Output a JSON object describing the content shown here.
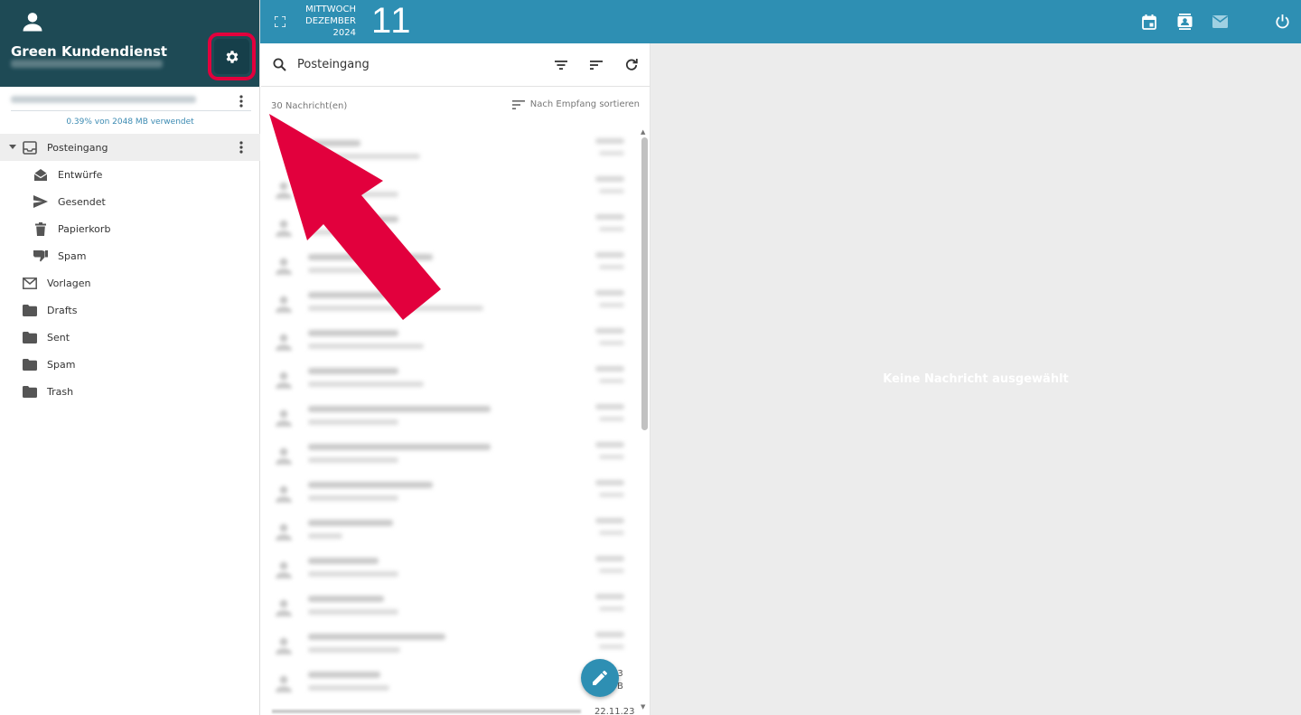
{
  "sidebar": {
    "user_name": "Green Kundendienst",
    "quota_text": "0.39% von 2048 MB verwendet",
    "folders": [
      {
        "label": "Posteingang",
        "icon": "inbox-icon",
        "active": true
      },
      {
        "label": "Entwürfe",
        "icon": "drafts-open-envelope-icon"
      },
      {
        "label": "Gesendet",
        "icon": "send-icon"
      },
      {
        "label": "Papierkorb",
        "icon": "trash-icon"
      },
      {
        "label": "Spam",
        "icon": "thumb-down-icon"
      },
      {
        "label": "Vorlagen",
        "icon": "mail-outline-icon"
      },
      {
        "label": "Drafts",
        "icon": "folder-icon"
      },
      {
        "label": "Sent",
        "icon": "folder-icon"
      },
      {
        "label": "Spam",
        "icon": "folder-icon"
      },
      {
        "label": "Trash",
        "icon": "folder-icon"
      }
    ]
  },
  "topbar": {
    "weekday": "MITTWOCH",
    "month": "DEZEMBER",
    "year": "2024",
    "day": "11",
    "icons": [
      "fullscreen-icon",
      "calendar-icon",
      "contacts-icon",
      "mail-icon",
      "power-icon"
    ]
  },
  "list": {
    "search_label": "Posteingang",
    "count_text": "30 Nachricht(en)",
    "sort_text": "Nach Empfang sortieren",
    "visible_dates": [
      "23",
      "B",
      "22.11.23"
    ]
  },
  "reading": {
    "empty_text": "Keine Nachricht ausgewählt"
  },
  "colors": {
    "header_dark": "#1e4a55",
    "topbar": "#2e8fb3",
    "highlight": "#e2003d"
  }
}
